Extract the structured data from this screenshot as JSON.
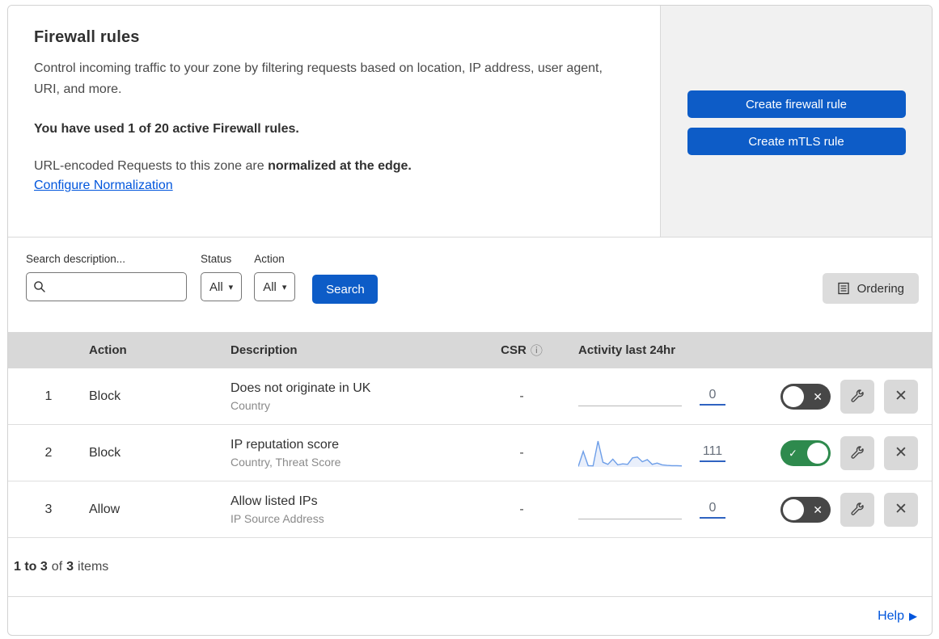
{
  "header": {
    "title": "Firewall rules",
    "description": "Control incoming traffic to your zone by filtering requests based on location, IP address, user agent, URI, and more.",
    "usage_notice": "You have used 1 of 20 active Firewall rules.",
    "normalization_prefix": "URL-encoded Requests to this zone are ",
    "normalization_bold": "normalized at the edge.",
    "normalization_link": "Configure Normalization",
    "create_firewall_label": "Create firewall rule",
    "create_mtls_label": "Create mTLS rule"
  },
  "filters": {
    "search_label": "Search description...",
    "search_placeholder": "",
    "search_value": "",
    "status_label": "Status",
    "status_value": "All",
    "action_label": "Action",
    "action_value": "All",
    "search_button_label": "Search",
    "ordering_button_label": "Ordering"
  },
  "table": {
    "columns": {
      "action": "Action",
      "description": "Description",
      "csr": "CSR",
      "activity": "Activity last 24hr"
    },
    "rows": [
      {
        "index": "1",
        "action": "Block",
        "description": "Does not originate in UK",
        "fields": "Country",
        "csr": "-",
        "activity_count": "0",
        "enabled": false
      },
      {
        "index": "2",
        "action": "Block",
        "description": "IP reputation score",
        "fields": "Country, Threat Score",
        "csr": "-",
        "activity_count": "111",
        "enabled": true
      },
      {
        "index": "3",
        "action": "Allow",
        "description": "Allow listed IPs",
        "fields": "IP Source Address",
        "csr": "-",
        "activity_count": "0",
        "enabled": false
      }
    ]
  },
  "chart_data": {
    "type": "area",
    "title": "Activity last 24hr sparkline (rule 2)",
    "total": 111,
    "values": [
      2,
      60,
      5,
      4,
      100,
      18,
      10,
      30,
      8,
      12,
      10,
      35,
      38,
      20,
      28,
      10,
      15,
      8,
      6,
      5,
      5,
      4
    ],
    "line_color": "#6d9ee8",
    "fill_color": "#e9effb"
  },
  "footer": {
    "range": "1 to 3",
    "of_word": "of",
    "total": "3",
    "items_word": "items",
    "help_label": "Help"
  },
  "icons": {
    "chevron_down": "▾",
    "info": "ⓘ",
    "toggle_x": "✕",
    "toggle_check": "✓",
    "close_x": "✕",
    "help_arrow": "▶"
  },
  "colors": {
    "primary_blue": "#0d5cc7",
    "link_blue": "#0055dc",
    "toggle_on_green": "#2e8a4d",
    "toggle_off_gray": "#474747",
    "header_gray": "#d8d8d8",
    "panel_gray": "#f1f1f1",
    "sparkline_blue": "#6d9ee8"
  }
}
